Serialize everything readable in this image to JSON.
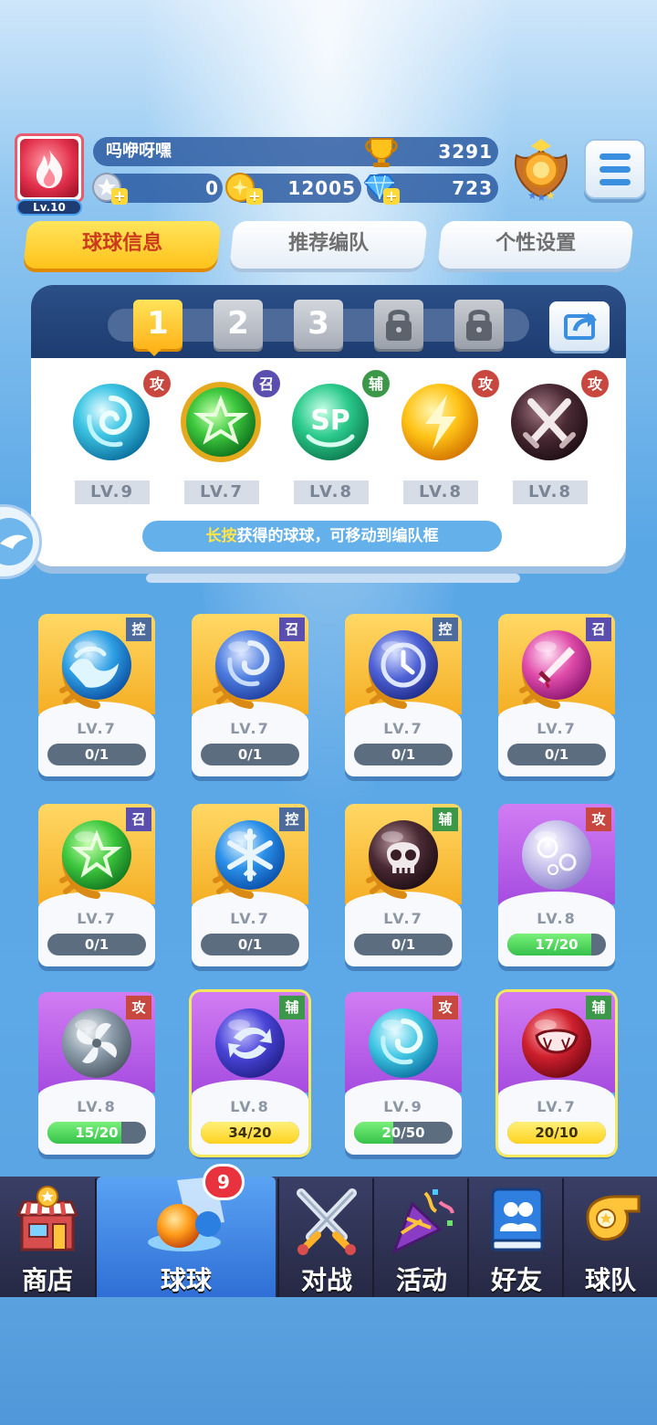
{
  "player": {
    "name": "吗咿呀嘿",
    "level": "Lv.10",
    "trophies": "3291",
    "silver": "0",
    "gold": "12005",
    "gems": "723"
  },
  "tabs": [
    {
      "label": "球球信息",
      "active": true
    },
    {
      "label": "推荐编队",
      "active": false
    },
    {
      "label": "个性设置",
      "active": false
    }
  ],
  "team": {
    "slots": [
      "1",
      "2",
      "3",
      "",
      ""
    ],
    "balls": [
      {
        "icon": "vortex-ball-icon",
        "type": "攻",
        "level": "LV.9"
      },
      {
        "icon": "green-star-ball-icon",
        "type": "召",
        "level": "LV.7"
      },
      {
        "icon": "sp-ball-icon",
        "type": "辅",
        "level": "LV.8"
      },
      {
        "icon": "lightning-ball-icon",
        "type": "攻",
        "level": "LV.8"
      },
      {
        "icon": "crossed-swords-ball-icon",
        "type": "攻",
        "level": "LV.8"
      }
    ],
    "tip_highlight": "长按",
    "tip_text": "获得的球球，可移动到编队框"
  },
  "collection": [
    {
      "icon": "wave-ball-icon",
      "type": "控",
      "level": "LV.7",
      "progress": "0/1",
      "frame": "gold",
      "fraction": 0
    },
    {
      "icon": "swirl-ball-icon",
      "type": "召",
      "level": "LV.7",
      "progress": "0/1",
      "frame": "gold",
      "fraction": 0
    },
    {
      "icon": "clock-ball-icon",
      "type": "控",
      "level": "LV.7",
      "progress": "0/1",
      "frame": "gold",
      "fraction": 0
    },
    {
      "icon": "dagger-ball-icon",
      "type": "召",
      "level": "LV.7",
      "progress": "0/1",
      "frame": "gold",
      "fraction": 0
    },
    {
      "icon": "green-star-ball-icon",
      "type": "召",
      "level": "LV.7",
      "progress": "0/1",
      "frame": "gold",
      "fraction": 0
    },
    {
      "icon": "snowflake-ball-icon",
      "type": "控",
      "level": "LV.7",
      "progress": "0/1",
      "frame": "gold",
      "fraction": 0
    },
    {
      "icon": "skull-ball-icon",
      "type": "辅",
      "level": "LV.7",
      "progress": "0/1",
      "frame": "gold",
      "fraction": 0
    },
    {
      "icon": "bubble-ball-icon",
      "type": "攻",
      "level": "LV.8",
      "progress": "17/20",
      "frame": "purple",
      "fraction": 0.85
    },
    {
      "icon": "fan-ball-icon",
      "type": "攻",
      "level": "LV.8",
      "progress": "15/20",
      "frame": "purple",
      "fraction": 0.75
    },
    {
      "icon": "arrows-ball-icon",
      "type": "辅",
      "level": "LV.8",
      "progress": "34/20",
      "frame": "purple",
      "fraction": 1
    },
    {
      "icon": "vortex-ball-icon",
      "type": "攻",
      "level": "LV.9",
      "progress": "20/50",
      "frame": "purple",
      "fraction": 0.4
    },
    {
      "icon": "fang-ball-icon",
      "type": "辅",
      "level": "LV.7",
      "progress": "20/10",
      "frame": "purple",
      "fraction": 1
    }
  ],
  "nav": [
    {
      "label": "商店",
      "icon": "shop-icon"
    },
    {
      "label": "球球",
      "icon": "ball-icon",
      "badge": "9"
    },
    {
      "label": "对战",
      "icon": "crossed-swords-icon"
    },
    {
      "label": "活动",
      "icon": "party-popper-icon"
    },
    {
      "label": "好友",
      "icon": "friends-book-icon"
    },
    {
      "label": "球队",
      "icon": "whistle-icon"
    }
  ],
  "colors": {
    "accent_yellow": "#ffc21a",
    "panel_navy": "#1d3c70",
    "attack": "#c8473f",
    "support": "#3d9748",
    "control": "#4d6a9c",
    "summon": "#5a4fae"
  }
}
